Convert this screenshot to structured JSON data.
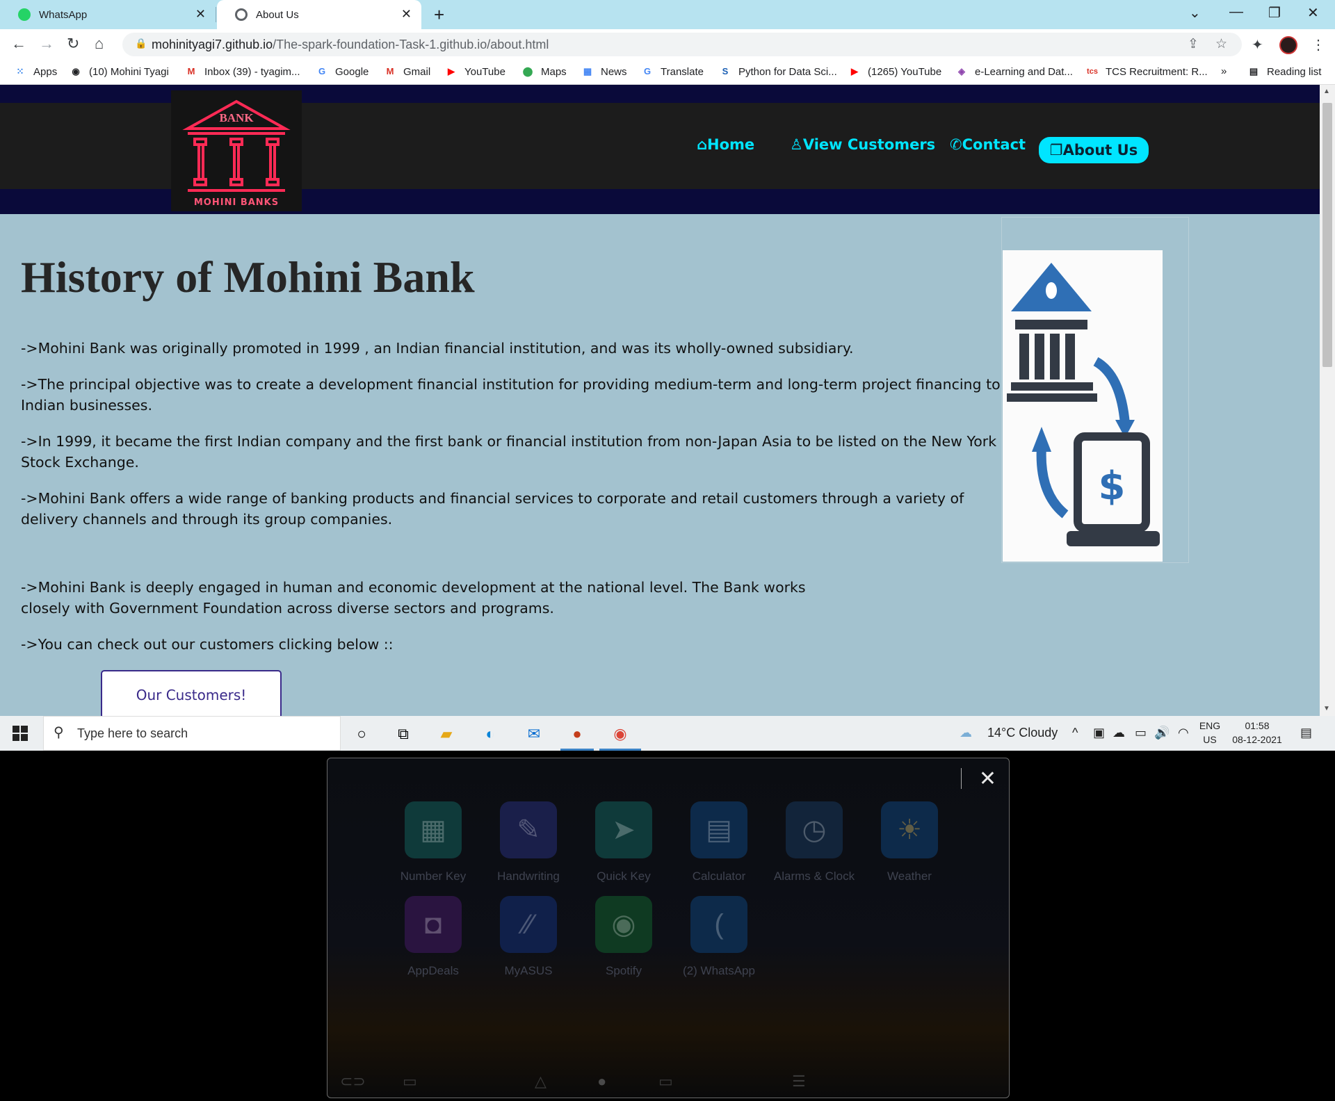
{
  "browser": {
    "tabs": [
      {
        "title": "WhatsApp",
        "active": false
      },
      {
        "title": "About Us",
        "active": true
      }
    ],
    "url_host": "mohinityagi7.github.io",
    "url_path": "/The-spark-foundation-Task-1.github.io/about.html",
    "bookmarks": [
      "Apps",
      "(10) Mohini Tyagi",
      "Inbox (39) - tyagim...",
      "Google",
      "Gmail",
      "YouTube",
      "Maps",
      "News",
      "Translate",
      "Python for Data Sci...",
      "(1265) YouTube",
      "e-Learning and Dat...",
      "TCS Recruitment: R..."
    ],
    "overflow_label": "»",
    "reading_list": "Reading list"
  },
  "site": {
    "logo_top": "BANK",
    "logo_bottom": "MOHINI BANKS",
    "nav": [
      {
        "label": "Home",
        "icon": "home-icon"
      },
      {
        "label": "View Customers",
        "icon": "user-icon"
      },
      {
        "label": "Contact",
        "icon": "phone-icon"
      },
      {
        "label": "About Us",
        "icon": "square-icon",
        "active": true
      }
    ],
    "heading": "History of Mohini Bank",
    "paragraphs": [
      "->Mohini Bank was originally promoted in 1999 , an Indian financial institution, and was its wholly-owned subsidiary.",
      "->The principal objective was to create a development financial institution for providing medium-term and long-term project financing to Indian businesses.",
      "->In 1999, it became the first Indian company and the first bank or financial institution from non-Japan Asia to be listed on the New York Stock Exchange.",
      "->Mohini Bank offers a wide range of banking products and financial services to corporate and retail customers through a variety of delivery channels and through its group companies.",
      "->Mohini Bank is deeply engaged in human and economic development at the national level. The Bank works closely with Government Foundation across diverse sectors and programs.",
      "->You can check out our customers clicking below ::"
    ],
    "customers_button": "Our Customers!",
    "accent_color": "#00e5ff",
    "background_color": "#a3c2cf"
  },
  "taskbar": {
    "search_placeholder": "Type here to search",
    "weather": "14°C  Cloudy",
    "lang_top": "ENG",
    "lang_bottom": "US",
    "time": "01:58",
    "date": "08-12-2021"
  },
  "overlay": {
    "apps": [
      {
        "label": "Number Key",
        "icon": "keypad-icon"
      },
      {
        "label": "Handwriting",
        "icon": "handwriting-icon"
      },
      {
        "label": "Quick Key",
        "icon": "send-icon"
      },
      {
        "label": "Calculator",
        "icon": "calculator-icon"
      },
      {
        "label": "Alarms & Clock",
        "icon": "clock-icon"
      },
      {
        "label": "Weather",
        "icon": "weather-icon"
      },
      {
        "label": "AppDeals",
        "icon": "shopping-bag-icon"
      },
      {
        "label": "MyASUS",
        "icon": "myasus-icon"
      },
      {
        "label": "Spotify",
        "icon": "spotify-icon"
      },
      {
        "label": "(2) WhatsApp",
        "icon": "whatsapp-icon"
      }
    ]
  }
}
